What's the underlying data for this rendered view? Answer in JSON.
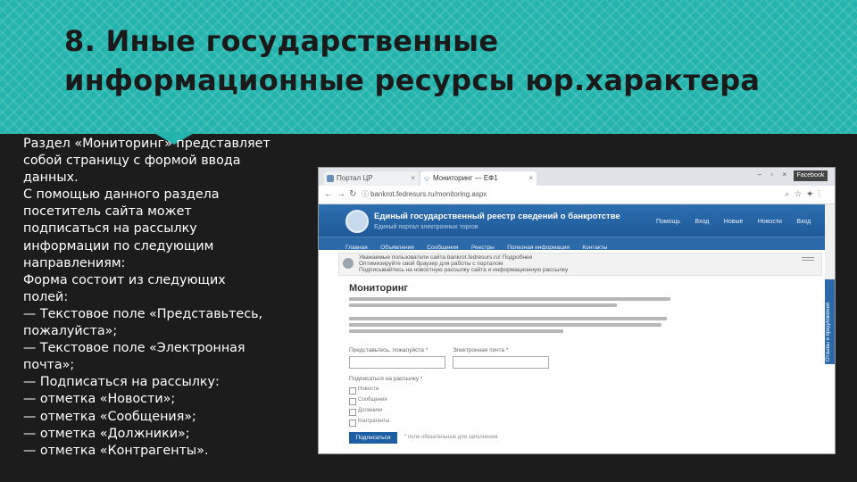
{
  "slide": {
    "title_lines": [
      "8. Иные государственные",
      "информационные ресурсы юр.характера"
    ],
    "body_lines": [
      "Раздел «Мониторинг» представляет",
      "собой страницу с формой ввода",
      "данных.",
      "С помощью данного раздела",
      "посетитель сайта может",
      "подписаться на рассылку",
      "информации по следующим",
      "направлениям:",
      "Форма состоит из следующих",
      "полей:",
      "— Текстовое поле «Представьтесь,",
      "пожалуйста»;",
      "— Текстовое поле «Электронная",
      "почта»;",
      "— Подписаться на рассылку:",
      "— отметка «Новости»;",
      "— отметка «Сообщения»;",
      "— отметка «Должники»;",
      "— отметка «Контрагенты»."
    ],
    "colors": {
      "header": "#25b4ad",
      "background": "#1c1c1c",
      "text": "#ffffff"
    }
  },
  "browser": {
    "tabs": [
      {
        "label": "Портал ЦР",
        "icon": "site-icon"
      },
      {
        "label": "Мониторинг — ЕФ1",
        "icon": "star-icon"
      }
    ],
    "user_badge": "Facebook",
    "url": "bankrot.fedresurs.ru/monitoring.aspx",
    "site": {
      "title": "Единый государственный реестр сведений о банкротстве",
      "subtitle": "Единый портал электронных торгов",
      "top_links": [
        "Помощь",
        "Вход",
        "Новые",
        "Новости",
        "Вход"
      ],
      "menu": [
        "Главная",
        "Объявления",
        "Сообщения",
        "Реестры",
        "Полезная информация",
        "Контакты"
      ],
      "notice_lines": [
        "Уважаемые пользователи сайта bankrot.fedresurs.ru! Подробнее",
        "Оптимизируйте свой браузер для работы с порталом",
        "Подписывайтесь на новостную рассылку сайта и информационную рассылку"
      ],
      "page_heading": "Мониторинг",
      "field_name_label": "Представьтесь, пожалуйста *",
      "field_email_label": "Электронная почта *",
      "subscribe_label": "Подписаться на рассылку *",
      "checkboxes": [
        "Новости",
        "Сообщения",
        "Должники",
        "Контрагенты"
      ],
      "submit_label": "Подписаться",
      "submit_note": "* поля обязательные для заполнения",
      "side_tab": "Отзывы и предложения"
    }
  }
}
